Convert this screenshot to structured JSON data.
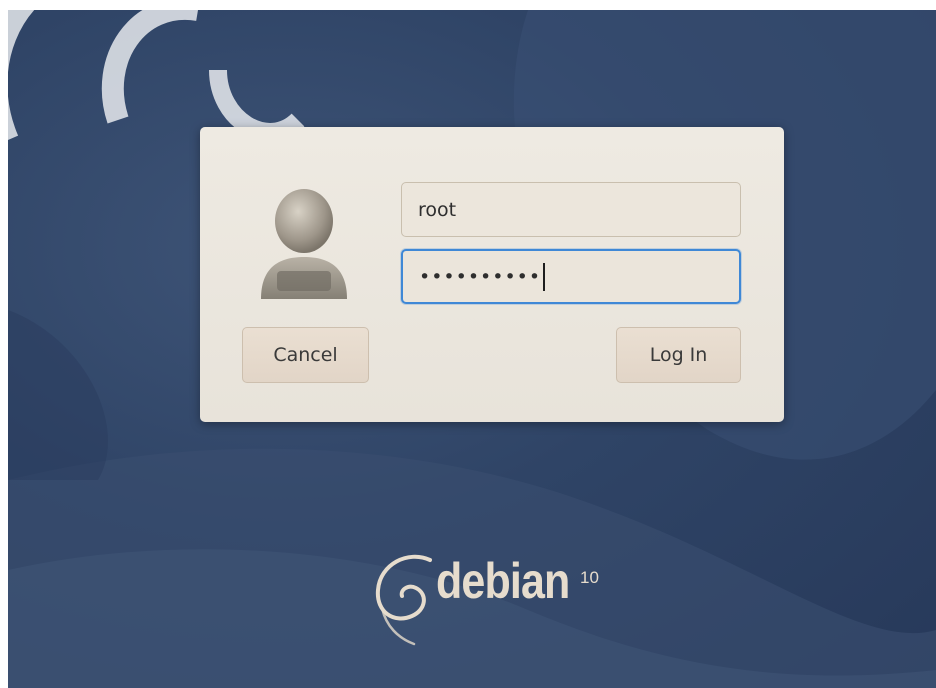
{
  "login": {
    "username_value": "root",
    "password_mask": "••••••••••",
    "cancel_label": "Cancel",
    "login_label": "Log In"
  },
  "branding": {
    "wordmark": "debian",
    "version": "10"
  },
  "colors": {
    "background": "#2f4466",
    "dialog": "#eceae2",
    "focus_border": "#3f88d6",
    "button": "#e6dacd",
    "logo": "#e6dccd"
  },
  "icons": {
    "avatar": "user-avatar-icon",
    "logo_swirl": "debian-swirl-icon"
  }
}
